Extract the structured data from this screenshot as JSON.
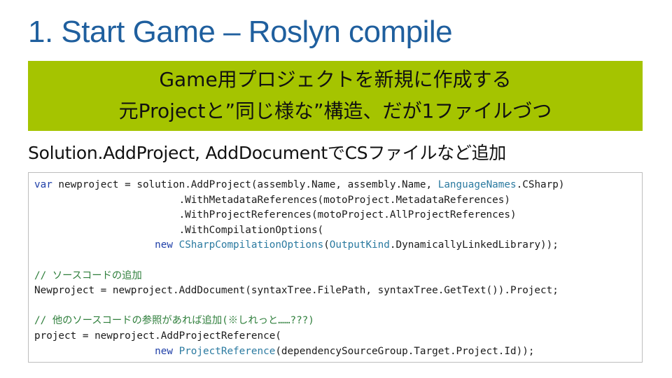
{
  "slide": {
    "title": "1. Start Game – Roslyn compile",
    "banner": {
      "line1": "Game用プロジェクトを新規に作成する",
      "line2": "元Projectと”同じ様な”構造、だが1ファイルづつ",
      "bg_color": "#a5c400"
    },
    "subtitle": "Solution.AddProject, AddDocumentでCSファイルなど追加"
  },
  "code": {
    "lines": [
      [
        [
          "kw",
          "var"
        ],
        [
          "",
          " newproject = solution.AddProject(assembly.Name, assembly.Name, "
        ],
        [
          "ty",
          "LanguageNames"
        ],
        [
          "",
          ".CSharp)"
        ]
      ],
      [
        [
          "",
          "                        .WithMetadataReferences(motoProject.MetadataReferences)"
        ]
      ],
      [
        [
          "",
          "                        .WithProjectReferences(motoProject.AllProjectReferences)"
        ]
      ],
      [
        [
          "",
          "                        .WithCompilationOptions("
        ]
      ],
      [
        [
          "",
          "                    "
        ],
        [
          "kw",
          "new"
        ],
        [
          "",
          " "
        ],
        [
          "ty",
          "CSharpCompilationOptions"
        ],
        [
          "",
          "("
        ],
        [
          "ty",
          "OutputKind"
        ],
        [
          "",
          ".DynamicallyLinkedLibrary));"
        ]
      ],
      [],
      [
        [
          "cm",
          "// ソースコードの追加"
        ]
      ],
      [
        [
          "",
          "Newproject = newproject.AddDocument(syntaxTree.FilePath, syntaxTree.GetText()).Project;"
        ]
      ],
      [],
      [
        [
          "cm",
          "// 他のソースコードの参照があれば追加(※しれっと……???)"
        ]
      ],
      [
        [
          "",
          "project = newproject.AddProjectReference("
        ]
      ],
      [
        [
          "",
          "                    "
        ],
        [
          "kw",
          "new"
        ],
        [
          "",
          " "
        ],
        [
          "ty",
          "ProjectReference"
        ],
        [
          "",
          "(dependencySourceGroup.Target.Project.Id));"
        ]
      ]
    ]
  }
}
